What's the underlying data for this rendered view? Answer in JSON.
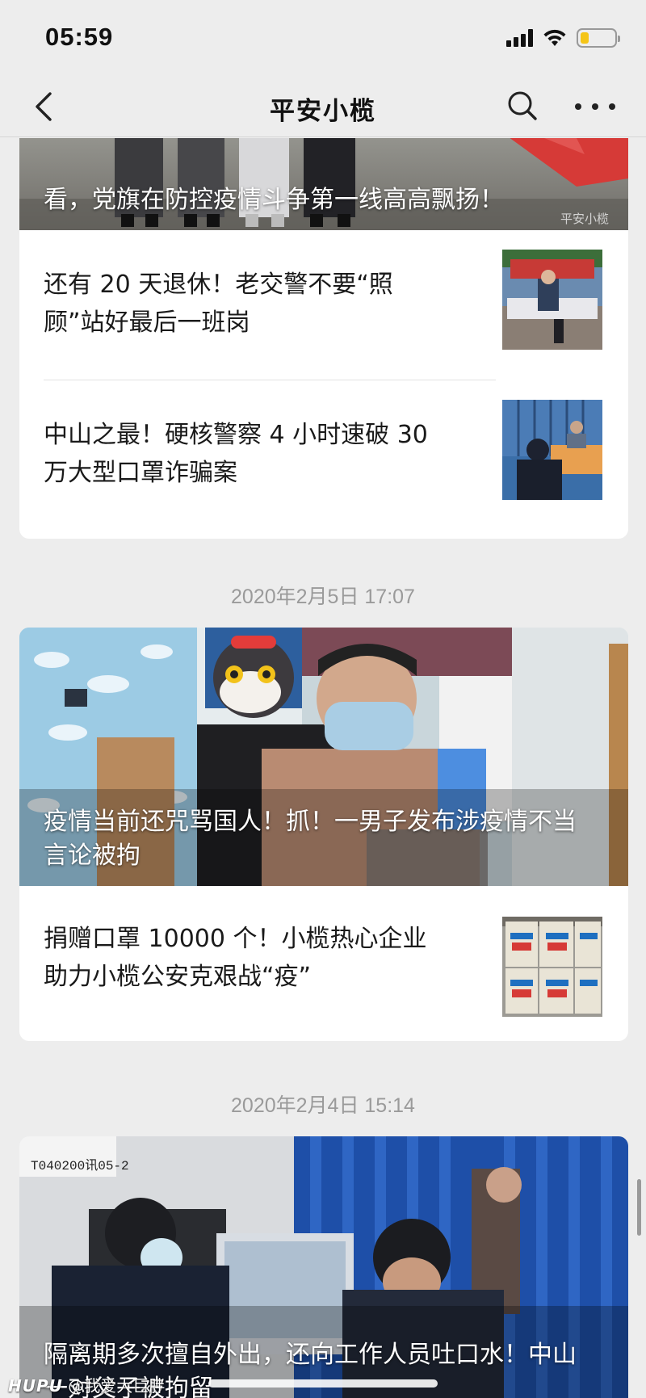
{
  "status_bar": {
    "time": "05:59",
    "battery_level": 0.25,
    "battery_color": "#f5c518"
  },
  "nav": {
    "title": "平安小榄",
    "icons": [
      "back-arrow-icon",
      "search-icon",
      "more-icon"
    ]
  },
  "groups": [
    {
      "hero": {
        "title": "看，党旗在防控疫情斗争第一线高高飘扬！",
        "watermark": "平安小榄"
      },
      "articles": [
        {
          "title": "还有 20 天退休！老交警不要“照顾”站好最后一班岗"
        },
        {
          "title": "中山之最！硬核警察 4 小时速破 30 万大型口罩诈骗案"
        }
      ]
    },
    {
      "date": "2020年2月5日 17:07",
      "hero": {
        "title": "疫情当前还咒骂国人！抓！一男子发布涉疫情不当言论被拘"
      },
      "articles": [
        {
          "title": "捐赠口罩 10000 个！小榄热心企业助力小榄公安克艰战“疫”"
        }
      ]
    },
    {
      "date": "2020年2月4日 15:14",
      "hero": {
        "title": "隔离期多次擅自外出，还向工作人员吐口水！中山一对父子被拘留",
        "sign_text": "T040200讯05-2"
      }
    }
  ],
  "footer": {
    "watermark_brand": "HUPU",
    "watermark_user": "@我爱大巨胖"
  },
  "colors": {
    "background": "#ededed",
    "card": "#ffffff",
    "date_text": "#9a9a9a"
  }
}
